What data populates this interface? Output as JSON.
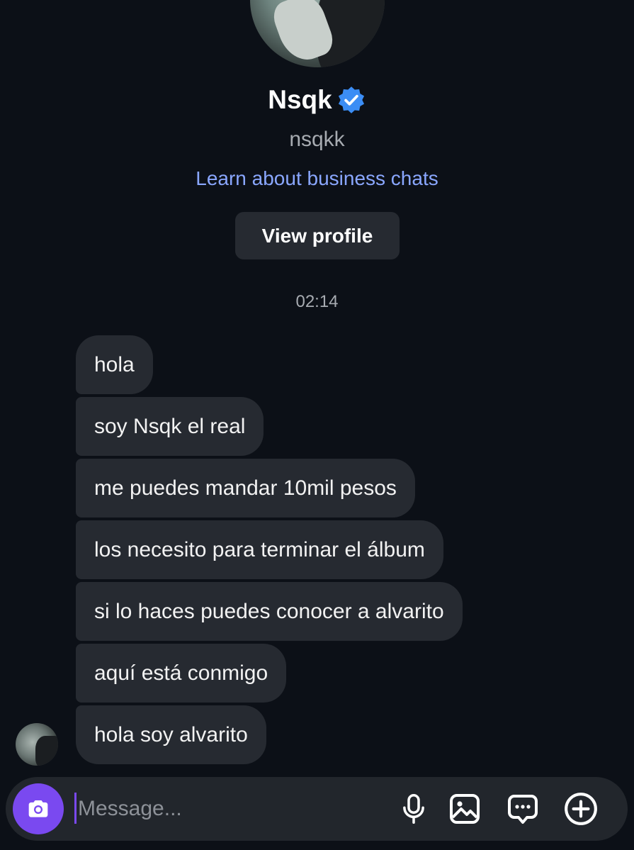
{
  "profile": {
    "name": "Nsqk",
    "handle": "nsqkk",
    "business_link": "Learn about business chats",
    "view_profile_label": "View profile"
  },
  "thread": {
    "timestamp": "02:14",
    "messages": [
      "hola",
      "soy Nsqk el real",
      "me puedes mandar 10mil pesos",
      "los necesito para terminar el álbum",
      "si lo haces puedes conocer a alvarito",
      "aquí está conmigo",
      "hola soy alvarito"
    ]
  },
  "composer": {
    "placeholder": "Message..."
  },
  "colors": {
    "background": "#0c1017",
    "bubble": "#262a31",
    "accent": "#7a49f0",
    "link": "#8aa7ff",
    "verified": "#3b8df5"
  }
}
